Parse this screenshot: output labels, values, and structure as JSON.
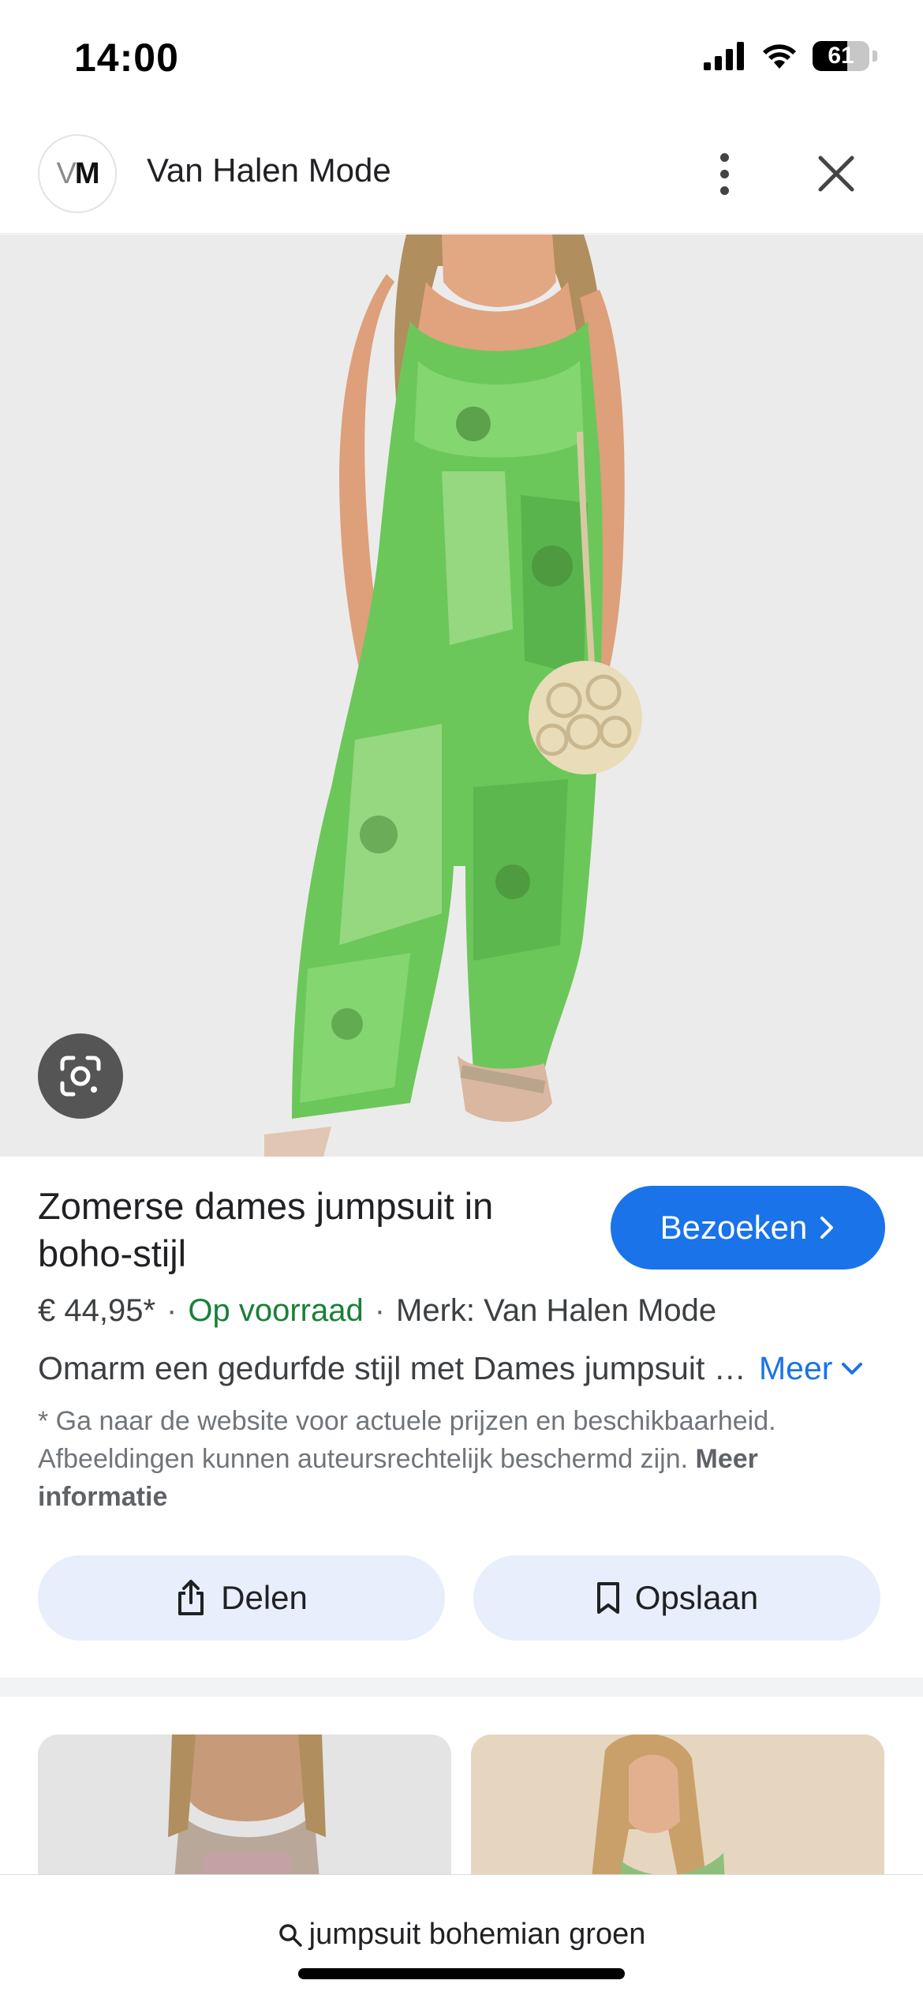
{
  "status_bar": {
    "time": "14:00",
    "battery": "61",
    "battery_level": 0.61,
    "signal_icon": "cellular-signal-icon",
    "wifi_icon": "wifi-icon"
  },
  "header": {
    "logo_text_v": "V",
    "logo_text_m": "M",
    "site_name": "Van Halen Mode",
    "more_icon": "more-vertical-icon",
    "close_icon": "close-icon"
  },
  "image": {
    "lens_icon": "google-lens-icon"
  },
  "product": {
    "title": "Zomerse dames jumpsuit in boho-stijl",
    "visit_label": "Bezoeken",
    "price": "€ 44,95*",
    "stock": "Op voorraad",
    "brand": "Merk: Van Halen Mode",
    "separator": "·",
    "description": "Omarm een gedurfde stijl met Dames jumpsuit in boho-stijl",
    "more_label": "Meer",
    "disclaimer": "* Ga naar de website voor actuele prijzen en beschikbaarheid. Afbeeldingen kunnen auteursrechtelijk beschermd zijn.",
    "more_info_label": "Meer informatie"
  },
  "actions": {
    "share_label": "Delen",
    "save_label": "Opslaan"
  },
  "search": {
    "query": "jumpsuit bohemian groen"
  },
  "colors": {
    "accent": "#1a73e8",
    "stock_green": "#188038",
    "chip_bg": "#e8eefb",
    "jumpsuit_green": "#6cc75a"
  }
}
